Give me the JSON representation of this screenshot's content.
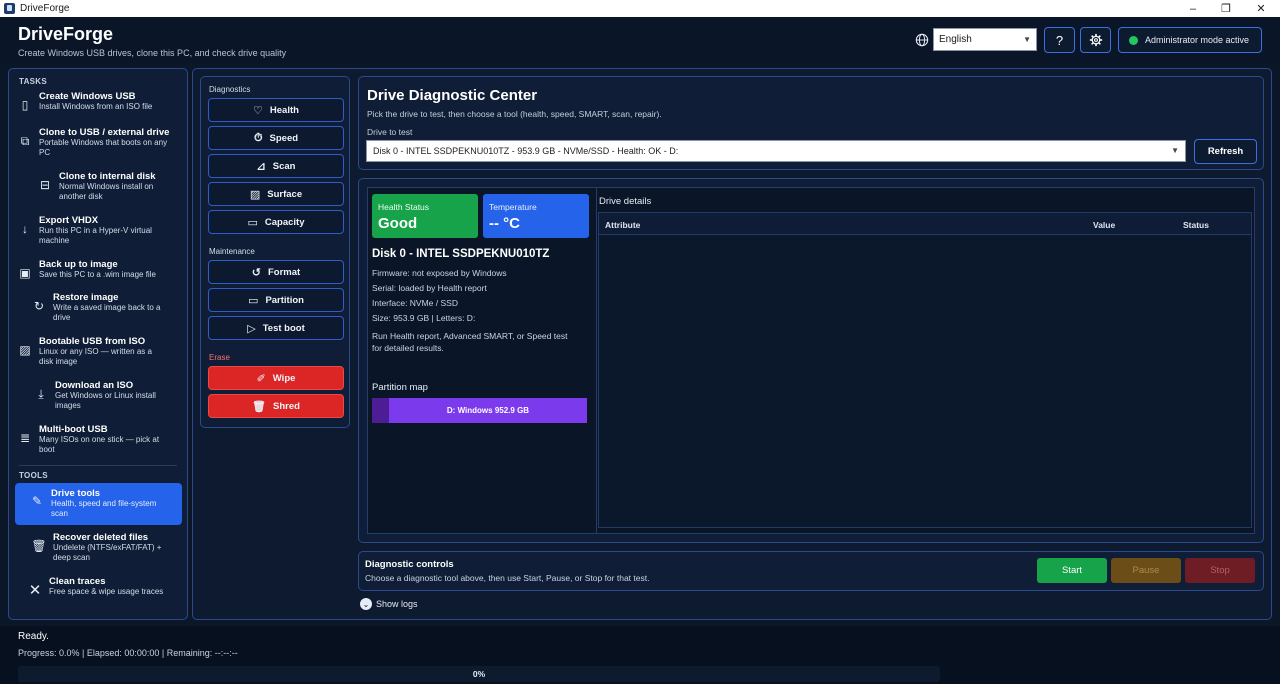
{
  "window": {
    "title": "DriveForge",
    "minimize": "–",
    "maximize": "❐",
    "close": "✕"
  },
  "header": {
    "title": "DriveForge",
    "subtitle": "Create Windows USB drives, clone this PC, and check drive quality",
    "language": "English",
    "help_label": "?",
    "settings_icon": "gear-icon",
    "admin_label": "Administrator mode active",
    "admin_status_color": "#22c55e"
  },
  "sidebar": {
    "tasks_label": "TASKS",
    "tools_label": "TOOLS",
    "tasks": [
      {
        "title": "Create Windows USB",
        "desc": "Install Windows from an ISO file",
        "icon": "usb-drive-icon"
      },
      {
        "title": "Clone to USB / external drive",
        "desc": "Portable Windows that boots on any PC",
        "icon": "copy-icon"
      },
      {
        "title": "Clone to internal disk",
        "desc": "Normal Windows install on another disk",
        "icon": "internal-disk-icon"
      },
      {
        "title": "Export VHDX",
        "desc": "Run this PC in a Hyper-V virtual machine",
        "icon": "download-arrow-icon"
      },
      {
        "title": "Back up to image",
        "desc": "Save this PC to a .wim image file",
        "icon": "floppy-disk-icon"
      },
      {
        "title": "Restore image",
        "desc": "Write a saved image back to a drive",
        "icon": "restore-icon"
      },
      {
        "title": "Bootable USB from ISO",
        "desc": "Linux or any ISO — written as a disk image",
        "icon": "image-icon"
      },
      {
        "title": "Download an ISO",
        "desc": "Get Windows or Linux install images",
        "icon": "download-icon"
      },
      {
        "title": "Multi-boot USB",
        "desc": "Many ISOs on one stick — pick at boot",
        "icon": "list-icon"
      }
    ],
    "tools": [
      {
        "title": "Drive tools",
        "desc": "Health, speed and file-system scan",
        "icon": "wrench-icon"
      },
      {
        "title": "Recover deleted files",
        "desc": "Undelete (NTFS/exFAT/FAT) + deep scan",
        "icon": "trash-icon"
      },
      {
        "title": "Clean traces",
        "desc": "Free space & wipe usage traces",
        "icon": "close-icon"
      }
    ]
  },
  "toolcol": {
    "diagnostics_label": "Diagnostics",
    "maintenance_label": "Maintenance",
    "erase_label": "Erase",
    "diagnostics": [
      "Health",
      "Speed",
      "Scan",
      "Surface",
      "Capacity"
    ],
    "maintenance": [
      "Format",
      "Partition",
      "Test boot"
    ],
    "erase": [
      "Wipe",
      "Shred"
    ]
  },
  "main": {
    "title": "Drive Diagnostic Center",
    "subtitle": "Pick the drive to test, then choose a tool (health, speed, SMART, scan, repair).",
    "drive_label": "Drive to test",
    "drive_value": "Disk 0 - INTEL SSDPEKNU010TZ - 953.9 GB - NVMe/SSD - Health: OK - D:",
    "refresh_label": "Refresh"
  },
  "drive": {
    "health_label": "Health Status",
    "health_value": "Good",
    "health_color": "#16a34a",
    "temp_label": "Temperature",
    "temp_value": "-- °C",
    "temp_color": "#2563eb",
    "name": "Disk 0 - INTEL SSDPEKNU010TZ",
    "firmware": "Firmware: not exposed by Windows",
    "serial": "Serial: loaded by Health report",
    "interface": "Interface: NVMe / SSD",
    "size": "Size: 953.9 GB | Letters: D:",
    "hint_line1": "Run Health report, Advanced SMART, or Speed test",
    "hint_line2": "for detailed results.",
    "partition_map_label": "Partition map",
    "partition_label": "D: Windows  952.9 GB"
  },
  "details": {
    "title": "Drive details",
    "columns": [
      "Attribute",
      "Value",
      "Status"
    ]
  },
  "controls": {
    "title": "Diagnostic controls",
    "subtitle": "Choose a diagnostic tool above, then use Start, Pause, or Stop for that test.",
    "start": "Start",
    "pause": "Pause",
    "stop": "Stop",
    "show_logs": "Show logs"
  },
  "status": {
    "state": "Ready.",
    "progress_text": "Progress: 0.0% | Elapsed: 00:00:00 | Remaining: --:--:--",
    "progress_percent": 0,
    "progress_label": "0%"
  }
}
